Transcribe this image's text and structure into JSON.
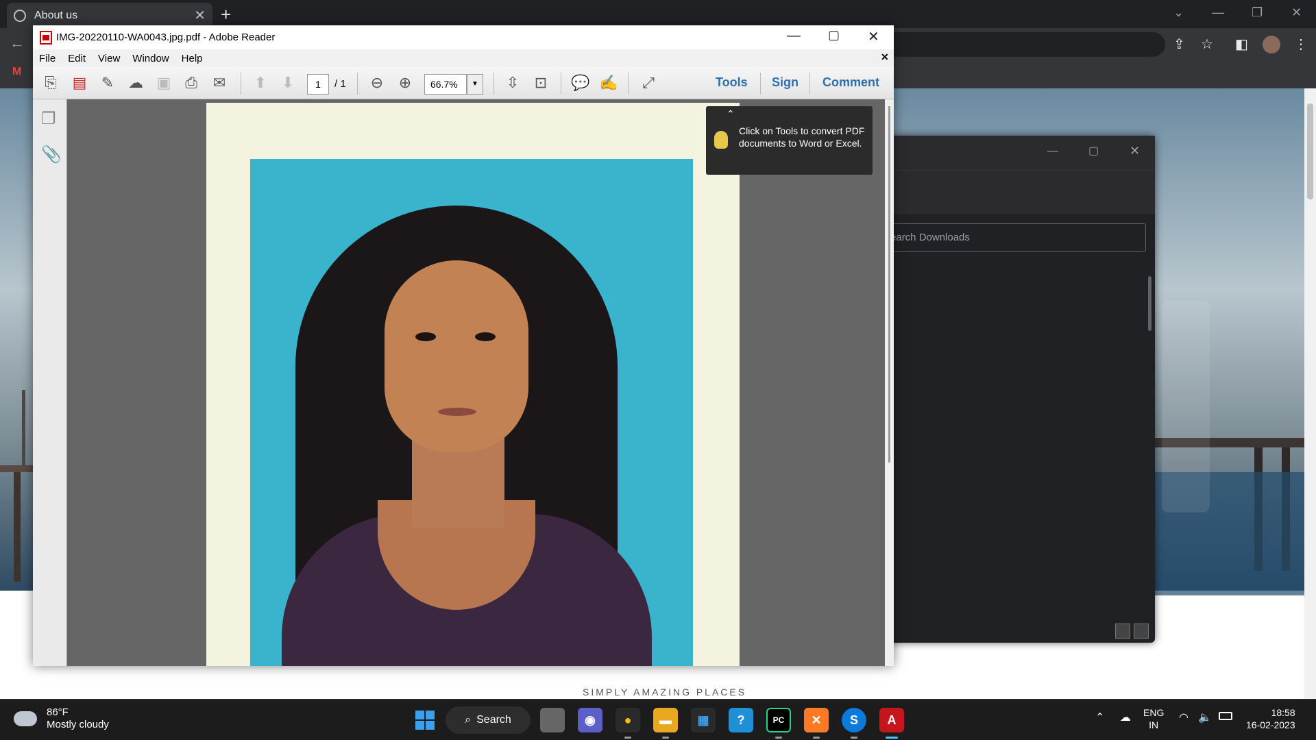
{
  "browser": {
    "tab_title": "About us",
    "tab_close": "✕",
    "new_tab": "+",
    "back": "←"
  },
  "webpage": {
    "tagline": "SIMPLY AMAZING PLACES"
  },
  "downloads": {
    "search_placeholder": "Search Downloads"
  },
  "reader": {
    "window_title": "IMG-20220110-WA0043.jpg.pdf - Adobe Reader",
    "menu": [
      "File",
      "Edit",
      "View",
      "Window",
      "Help"
    ],
    "page_current": "1",
    "page_total": "/ 1",
    "zoom": "66.7%",
    "right_buttons": {
      "tools": "Tools",
      "sign": "Sign",
      "comment": "Comment"
    },
    "tip_text": "Click on Tools to convert PDF documents to Word or Excel."
  },
  "taskbar": {
    "weather_temp": "86°F",
    "weather_desc": "Mostly cloudy",
    "search_label": "Search",
    "lang_line1": "ENG",
    "lang_line2": "IN",
    "time": "18:58",
    "date": "16-02-2023"
  },
  "colors": {
    "reader_link_blue": "#2f6fae",
    "chrome_dark": "#202124",
    "photo_backdrop": "#3ab3cc"
  }
}
